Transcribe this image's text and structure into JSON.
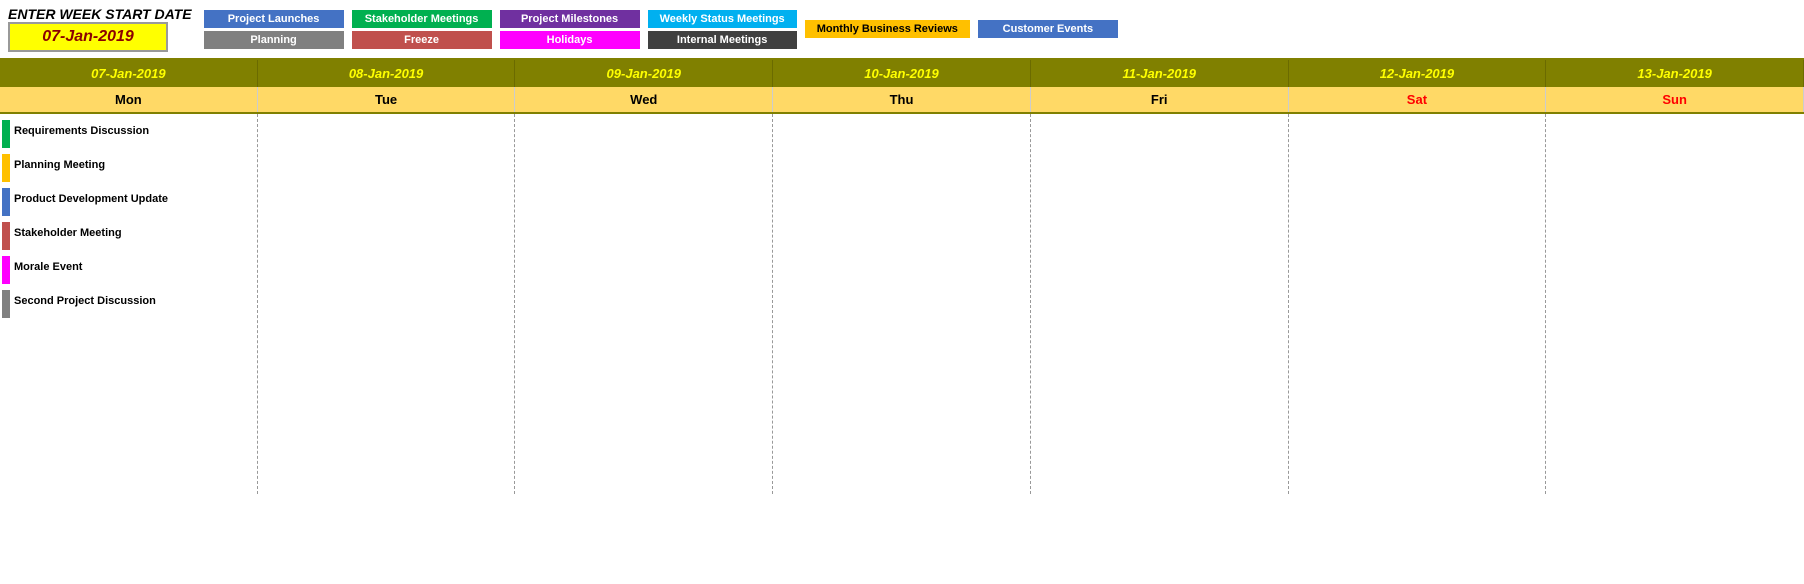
{
  "header": {
    "enter_label": "ENTER WEEK START DATE",
    "date_value": "07-Jan-2019"
  },
  "legend": {
    "groups": [
      {
        "items": [
          {
            "label": "Project Launches",
            "color": "#4472C4"
          },
          {
            "label": "Planning",
            "color": "#808080"
          }
        ]
      },
      {
        "items": [
          {
            "label": "Stakeholder Meetings",
            "color": "#00B050"
          },
          {
            "label": "Freeze",
            "color": "#C0504D"
          }
        ]
      },
      {
        "items": [
          {
            "label": "Project Milestones",
            "color": "#7030A0"
          },
          {
            "label": "Holidays",
            "color": "#FF00FF"
          }
        ]
      },
      {
        "items": [
          {
            "label": "Weekly Status Meetings",
            "color": "#00B0F0"
          },
          {
            "label": "Internal Meetings",
            "color": "#404040"
          }
        ]
      },
      {
        "items": [
          {
            "label": "Monthly Business Reviews",
            "color": "#FFC000"
          }
        ]
      },
      {
        "items": [
          {
            "label": "Customer Events",
            "color": "#4472C4"
          }
        ]
      }
    ]
  },
  "calendar": {
    "date_headers": [
      "07-Jan-2019",
      "08-Jan-2019",
      "09-Jan-2019",
      "10-Jan-2019",
      "11-Jan-2019",
      "12-Jan-2019",
      "13-Jan-2019"
    ],
    "day_names": [
      {
        "label": "Mon",
        "weekend": false
      },
      {
        "label": "Tue",
        "weekend": false
      },
      {
        "label": "Wed",
        "weekend": false
      },
      {
        "label": "Thu",
        "weekend": false
      },
      {
        "label": "Fri",
        "weekend": false
      },
      {
        "label": "Sat",
        "weekend": true
      },
      {
        "label": "Sun",
        "weekend": true
      }
    ],
    "events": [
      {
        "day": 0,
        "items": [
          {
            "label": "Requirements Discussion",
            "color": "#00B050"
          },
          {
            "label": "Planning Meeting",
            "color": "#FFC000"
          },
          {
            "label": "Product Development Update",
            "color": "#4472C4"
          },
          {
            "label": "Stakeholder Meeting",
            "color": "#C0504D"
          },
          {
            "label": "Morale Event",
            "color": "#FF00FF"
          },
          {
            "label": "Second Project Discussion",
            "color": "#808080"
          }
        ]
      },
      {
        "day": 1,
        "items": []
      },
      {
        "day": 2,
        "items": []
      },
      {
        "day": 3,
        "items": []
      },
      {
        "day": 4,
        "items": []
      },
      {
        "day": 5,
        "items": []
      },
      {
        "day": 6,
        "items": []
      }
    ]
  }
}
